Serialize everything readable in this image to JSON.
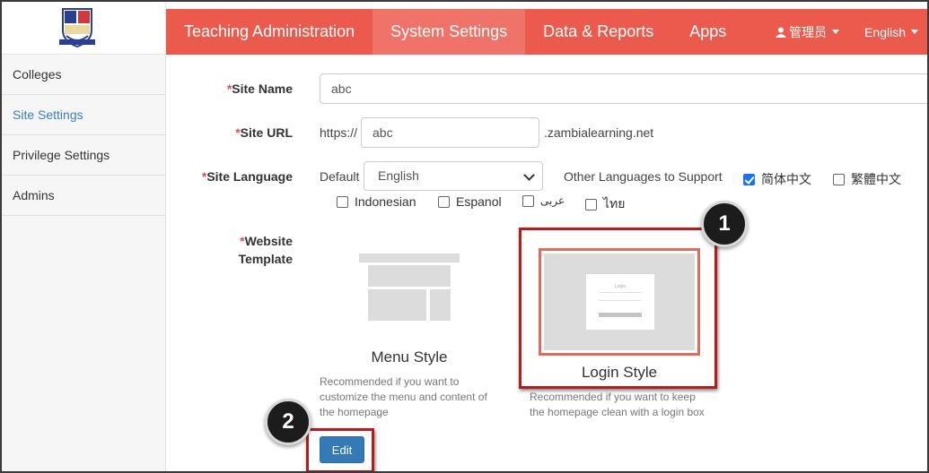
{
  "nav": {
    "items": [
      {
        "label": "Teaching Administration",
        "active": false
      },
      {
        "label": "System Settings",
        "active": true
      },
      {
        "label": "Data & Reports",
        "active": false
      },
      {
        "label": "Apps",
        "active": false
      }
    ],
    "user_label": "管理员",
    "language_label": "English"
  },
  "sidebar": {
    "items": [
      {
        "label": "Colleges",
        "active": false
      },
      {
        "label": "Site Settings",
        "active": true
      },
      {
        "label": "Privilege Settings",
        "active": false
      },
      {
        "label": "Admins",
        "active": false
      }
    ]
  },
  "form": {
    "required_mark": "*",
    "site_name": {
      "label": "Site Name",
      "value": "abc"
    },
    "site_url": {
      "label": "Site URL",
      "prefix": "https://",
      "value": "abc",
      "suffix": ".zambialearning.net"
    },
    "site_language": {
      "label": "Site Language",
      "default_label": "Default",
      "default_value": "English",
      "other_label": "Other Languages to Support",
      "options": [
        {
          "label": "简体中文",
          "checked": true
        },
        {
          "label": "繁體中文",
          "checked": false
        },
        {
          "label": "Indonesian",
          "checked": false
        },
        {
          "label": "Espanol",
          "checked": false
        },
        {
          "label": "عربى",
          "checked": false
        },
        {
          "label": "ไทย",
          "checked": false
        }
      ]
    },
    "website_template": {
      "label_line1": "Website",
      "label_line2": "Template",
      "menu_style": {
        "title": "Menu Style",
        "desc_lines": [
          "Recommended if you want to",
          "customize the menu and content of",
          "the homepage"
        ]
      },
      "login_style": {
        "title": "Login Style",
        "desc_lines": [
          "Recommended if you want to keep",
          "the homepage clean with a login box"
        ],
        "preview_text": "Login"
      }
    },
    "edit_label": "Edit"
  },
  "annotations": {
    "step1": "1",
    "step2": "2"
  },
  "colors": {
    "navbar": "#ec5a4d",
    "nav_active": "#ef7368",
    "highlight": "#b01e1e",
    "primary_button": "#337ab7",
    "link_active": "#3a7fc1"
  }
}
